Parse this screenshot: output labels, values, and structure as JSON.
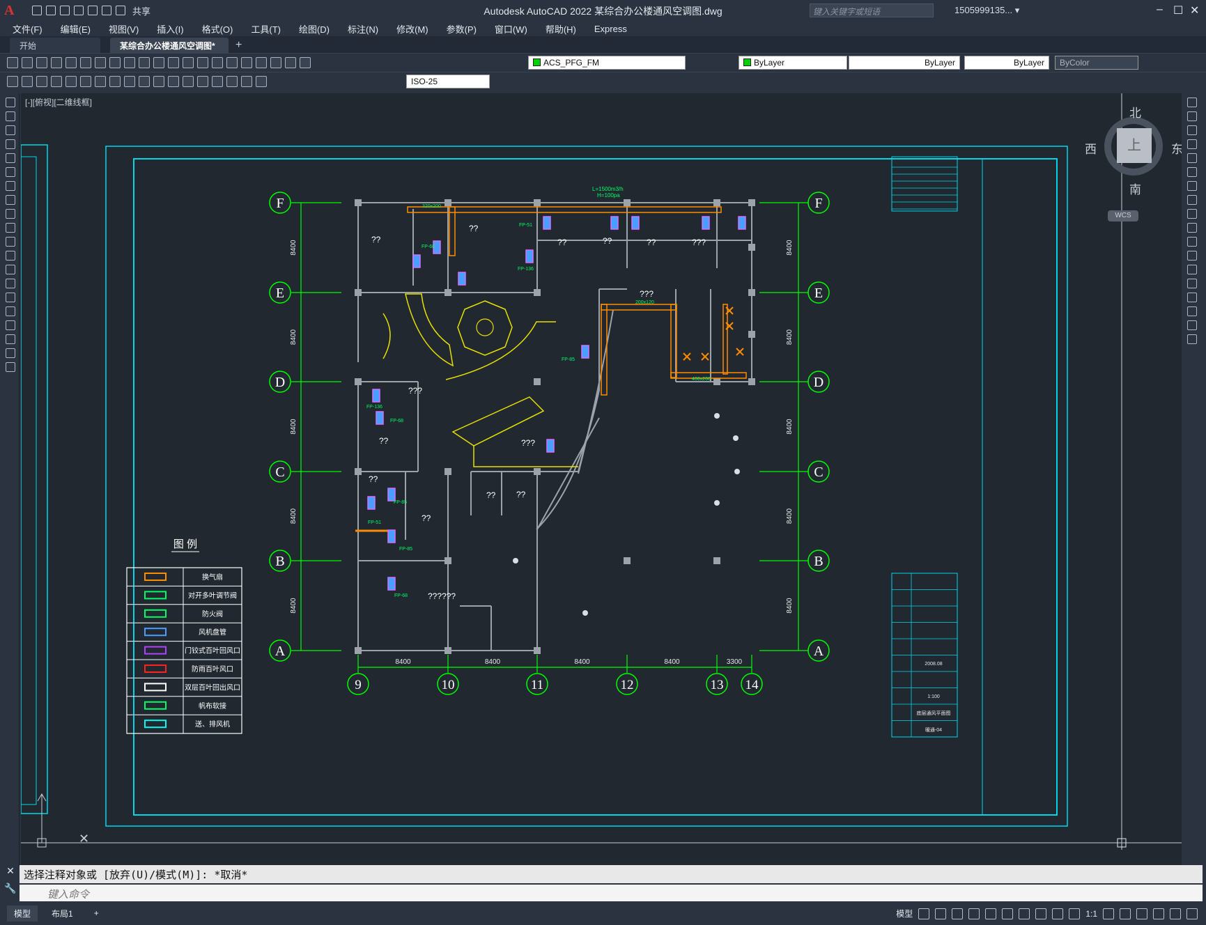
{
  "app": {
    "title": "Autodesk AutoCAD 2022    某综合办公楼通风空调图.dwg",
    "logo": "A",
    "share_label": "共享",
    "search_placeholder": "键入关键字或短语",
    "user": "1505999135... ▾"
  },
  "menu": [
    "文件(F)",
    "编辑(E)",
    "视图(V)",
    "插入(I)",
    "格式(O)",
    "工具(T)",
    "绘图(D)",
    "标注(N)",
    "修改(M)",
    "参数(P)",
    "窗口(W)",
    "帮助(H)",
    "Express"
  ],
  "tabs": [
    {
      "label": "开始"
    },
    {
      "label": "某综合办公楼通风空调图*"
    }
  ],
  "toolbar": {
    "layer": "ACS_PFG_FM",
    "color": "ByLayer",
    "linetype": "ByLayer",
    "lineweight": "ByLayer",
    "plotstyle": "ByColor",
    "dimstyle": "ISO-25"
  },
  "viewport_label": "[-][俯视][二维线框]",
  "viewcube": {
    "north": "北",
    "south": "南",
    "east": "东",
    "west": "西",
    "top": "上",
    "wcs": "WCS"
  },
  "legend": {
    "title": "图  例",
    "items": [
      "换气扇",
      "对开多叶调节阀",
      "防火阀",
      "风机盘管",
      "门铰式百叶回风口",
      "防雨百叶风口",
      "双层百叶回出风口",
      "帆布软接",
      "送、排风机"
    ]
  },
  "grid": {
    "rows": [
      "F",
      "E",
      "D",
      "C",
      "B",
      "A"
    ],
    "cols": [
      "9",
      "10",
      "11",
      "12",
      "13",
      "14"
    ],
    "col_dims": [
      "8400",
      "8400",
      "8400",
      "8400",
      "3300"
    ],
    "row_dims": [
      "8400",
      "8400",
      "8400",
      "8400",
      "8400"
    ]
  },
  "plan_notes": {
    "fan_spec_1": "L=1500m3/h",
    "fan_spec_2": "H=100pa",
    "duct_size_1": "320x200",
    "duct_size_2": "200x120",
    "duct_size_3": "400x200",
    "fp_labels": [
      "FP-51",
      "FP-68",
      "FP-136",
      "FP-85",
      "FP-136",
      "FP-68",
      "FP-85",
      "FP-51",
      "FP-85",
      "FP-68"
    ],
    "room_marks": [
      "??",
      "??",
      "??",
      "??",
      "??",
      "???",
      "???",
      "???",
      "??",
      "???",
      "??",
      "??",
      "??",
      "??",
      "??????"
    ]
  },
  "titleblock": {
    "date": "2008.08",
    "scale": "1:100",
    "drawing_name": "底层通风平面图",
    "drawing_no": "暖通-04"
  },
  "command": {
    "history": "选择注释对象或 [放弃(U)/模式(M)]: *取消*",
    "input_placeholder": "键入命令"
  },
  "status": {
    "layout_tabs": [
      "模型",
      "布局1"
    ],
    "model_label": "模型",
    "scale": "1:1"
  },
  "colors": {
    "accent_grid": "#00ff00",
    "frame": "#00d8e8",
    "wall": "#9da3aa",
    "stair": "#e8e000",
    "duct": "#ff8c00",
    "background": "#212830"
  }
}
